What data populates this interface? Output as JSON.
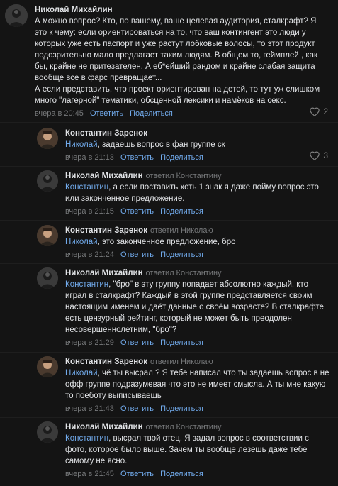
{
  "comments": [
    {
      "author": "Николай Михайлин",
      "reply_to": "",
      "mention": "",
      "text": "А можно вопрос? Кто, по вашему, ваше целевая аудитория, сталкрафт? Я это к чему: если ориентироваться на то, что ваш контингент это люди у которых уже есть паспорт и уже растут лобковые волосы, то этот продукт подозрительно мало предлагает таким людям. В общем то, геймплей , как бы, крайне не притезателен. А еб*ейший рандом и крайне слабая защита вообще все в фарс превращает...\nА если представить, что проект ориентирован на детей, то тут уж слишком много \"лагерной\" тематики, обсценной лексики и намёков на секс.",
      "date": "вчера в 20:45",
      "reply_label": "Ответить",
      "share_label": "Поделиться",
      "likes": "2"
    },
    {
      "author": "Константин Заренок",
      "reply_to": "",
      "mention": "Николай",
      "text": ", задаешь вопрос в фан группе ск",
      "date": "вчера в 21:13",
      "reply_label": "Ответить",
      "share_label": "Поделиться",
      "likes": "3"
    },
    {
      "author": "Николай Михайлин",
      "reply_to": "ответил Константину",
      "mention": "Константин",
      "text": ", а если поставить хоть 1 знак я даже пойму вопрос это или законченное предложение.",
      "date": "вчера в 21:15",
      "reply_label": "Ответить",
      "share_label": "Поделиться",
      "likes": ""
    },
    {
      "author": "Константин Заренок",
      "reply_to": "ответил Николаю",
      "mention": "Николай",
      "text": ", это законченное предложение, бро",
      "date": "вчера в 21:24",
      "reply_label": "Ответить",
      "share_label": "Поделиться",
      "likes": ""
    },
    {
      "author": "Николай Михайлин",
      "reply_to": "ответил Константину",
      "mention": "Константин",
      "text": ", \"бро\" в эту группу попадает абсолютно каждый, кто играл в сталкрафт? Каждый в этой группе представляется своим настоящим именем и даёт данные о своём возрасте? В сталкрафте есть цензурный рейтинг, который не может быть преодолен несовершеннолетним, \"бро\"?",
      "date": "вчера в 21:29",
      "reply_label": "Ответить",
      "share_label": "Поделиться",
      "likes": ""
    },
    {
      "author": "Константин Заренок",
      "reply_to": "ответил Николаю",
      "mention": "Николай",
      "text": ", чё ты высрал ? Я тебе написал что ты задаешь вопрос в не офф группе подразумевая что это не имеет смысла. А ты мне какую то поеботу выписываешь",
      "date": "вчера в 21:43",
      "reply_label": "Ответить",
      "share_label": "Поделиться",
      "likes": ""
    },
    {
      "author": "Николай Михайлин",
      "reply_to": "ответил Константину",
      "mention": "Константин",
      "text": ", высрал твой отец. Я задал вопрос в соответствии с фото, которое было выше. Зачем ты вообще лезешь даже тебе самому не ясно.",
      "date": "вчера в 21:45",
      "reply_label": "Ответить",
      "share_label": "Поделиться",
      "likes": ""
    }
  ],
  "colors": {
    "background": "#141414",
    "text": "#e1e3e6",
    "link": "#71aaeb",
    "secondary": "#76787a"
  }
}
